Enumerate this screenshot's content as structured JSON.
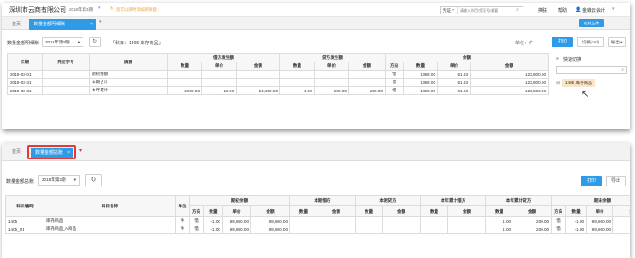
{
  "top": {
    "company": "深圳市云商有限公司",
    "period_selector": "2018年第3期",
    "notice": "您可以随时添加新账套",
    "search_type": "凭证",
    "search_placeholder": "请输入科目/凭证号/摘要",
    "header_links": [
      "换肤",
      "帮助"
    ],
    "user": "金蝶云会计",
    "tabs": [
      {
        "label": "首页"
      },
      {
        "label": "数量金额明细账"
      }
    ],
    "trial_button": "在线上传",
    "toolbar": {
      "title": "数量金额明细账",
      "period": "2018年第3期",
      "subject": "「科目：1405 库存商品」",
      "unit": "单位：件",
      "print": "打印",
      "switch": "切换(ctrl)",
      "export": "导出"
    },
    "table": {
      "group_headers": [
        "借方发生额",
        "贷方发生额",
        "余额"
      ],
      "headers": [
        "日期",
        "凭证字号",
        "摘要",
        "数量",
        "单价",
        "金额",
        "数量",
        "单价",
        "金额",
        "方向",
        "数量",
        "单价",
        "金额"
      ],
      "rows": [
        [
          "2018-03-01",
          "",
          "期初余额",
          "",
          "",
          "",
          "",
          "",
          "",
          "借",
          "1999.00",
          "61.93",
          "123,800.00"
        ],
        [
          "2018-03-31",
          "",
          "本期合计",
          "",
          "",
          "",
          "",
          "",
          "",
          "借",
          "1999.00",
          "61.93",
          "123,800.00"
        ],
        [
          "2018-03-31",
          "",
          "本年累计",
          "2000.00",
          "12.00",
          "24,000.00",
          "1.00",
          "200.00",
          "200.00",
          "借",
          "1999.00",
          "61.93",
          "123,800.00"
        ]
      ]
    },
    "side_panel": {
      "title": "快速切换",
      "item": "1405 库存商品"
    }
  },
  "bottom": {
    "tabs": [
      {
        "label": "首页"
      },
      {
        "label": "数量金额总账"
      }
    ],
    "toolbar": {
      "title": "数量金额总账",
      "period": "2018年第2期",
      "print": "打印",
      "export": "导出"
    },
    "table": {
      "top_headers": [
        "科目编码",
        "科目名称",
        "单位",
        "期初余额",
        "本期借方",
        "本期贷方",
        "本年累计借方",
        "本年累计贷方",
        "期末余额"
      ],
      "sub_headers": [
        "方向",
        "数量",
        "单价",
        "金额",
        "数量",
        "金额",
        "数量",
        "金额",
        "数量",
        "金额",
        "数量",
        "金额",
        "方向",
        "数量",
        "单价",
        "金额"
      ],
      "rows": [
        [
          "1405",
          "库存商品",
          "件",
          "借",
          "-1.00",
          "99,800.00",
          "99,800.00",
          "",
          "",
          "",
          "",
          "",
          "",
          "1.00",
          "200.00",
          "借",
          "-1.00",
          "99,800.00",
          "99,800.00"
        ],
        [
          "1405_01",
          "库存商品_A商品",
          "件",
          "借",
          "-1.00",
          "99,800.00",
          "99,800.00",
          "",
          "",
          "",
          "",
          "",
          "",
          "1.00",
          "200.00",
          "借",
          "-1.00",
          "99,800.00",
          "99,800.00"
        ]
      ]
    }
  },
  "colors": {
    "accent": "#2f9be7",
    "highlight_border": "#e53935",
    "side_item_bg": "#fbe5c8"
  }
}
